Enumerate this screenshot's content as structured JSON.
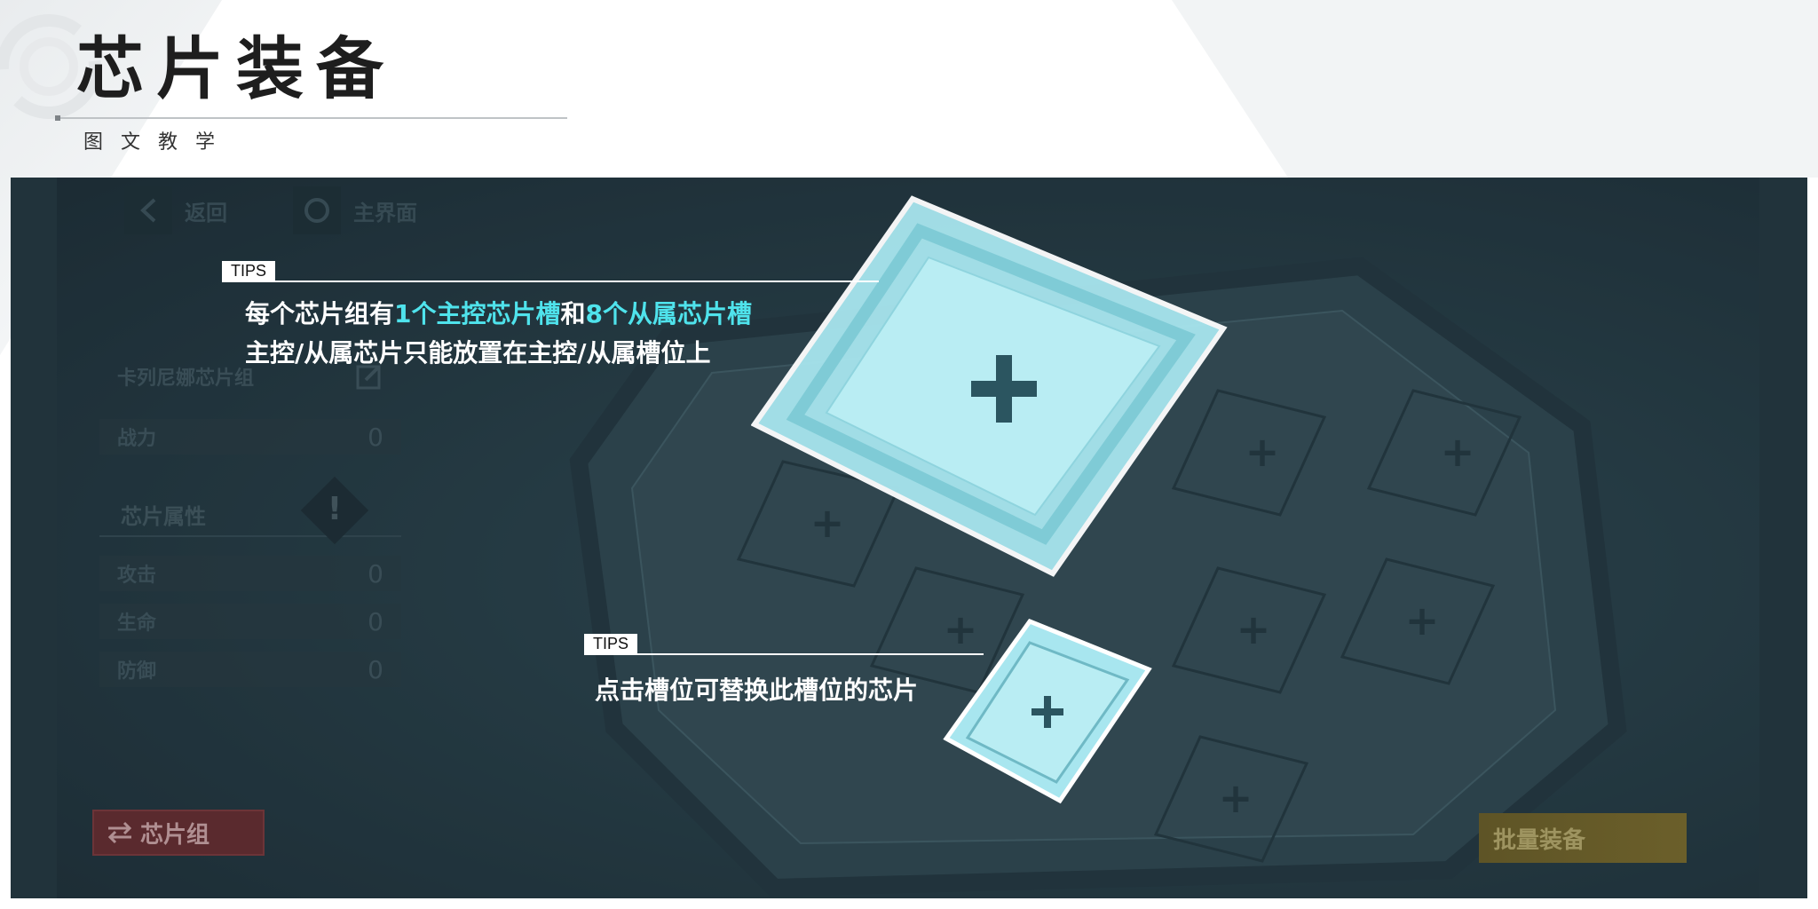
{
  "header": {
    "title": "芯片装备",
    "subtitle": "图文教学"
  },
  "game_ui": {
    "back_label": "返回",
    "home_label": "主界面",
    "chip_group_name": "卡列尼娜芯片组",
    "power_label": "战力",
    "power_value": "0",
    "attributes_title": "芯片属性",
    "attributes": [
      {
        "label": "攻击",
        "value": "0"
      },
      {
        "label": "生命",
        "value": "0"
      },
      {
        "label": "防御",
        "value": "0"
      }
    ],
    "chip_group_button": "芯片组",
    "batch_equip_button": "批量装备"
  },
  "tips": [
    {
      "label": "TIPS",
      "line1_a": "每个芯片组有",
      "line1_b": "1个主控芯片槽",
      "line1_c": "和",
      "line1_d": "8个从属芯片槽",
      "line2": "主控/从属芯片只能放置在主控/从属槽位上"
    },
    {
      "label": "TIPS",
      "line1": "点击槽位可替换此槽位的芯片"
    }
  ],
  "colors": {
    "highlight": "#4fe3ec",
    "slot_highlight": "#a8e6ef",
    "panel_bg": "#2a3c44"
  }
}
